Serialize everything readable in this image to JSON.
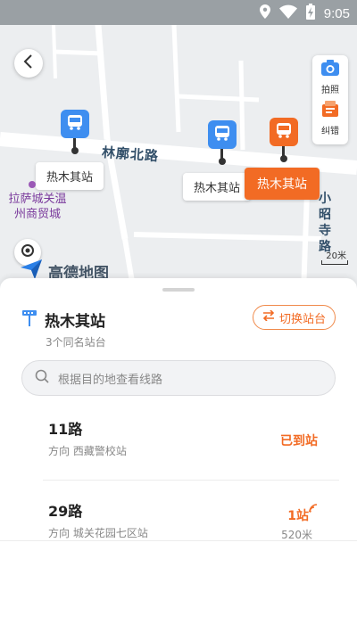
{
  "status_bar": {
    "time": "9:05"
  },
  "map": {
    "road_north": "林廓北路",
    "road_east": "小昭寺路",
    "poi_name_line1": "拉萨城关温",
    "poi_name_line2": "州商贸城",
    "station_labels": [
      "热木其站",
      "热木其站",
      "热木其站"
    ],
    "scale": "20米",
    "logo_text": "高德地图",
    "tools": {
      "photo": "拍照",
      "report": "纠错"
    }
  },
  "sheet": {
    "stop_name": "热木其站",
    "stop_sub": "3个同名站台",
    "switch_label": "切换站台",
    "search_placeholder": "根据目的地查看线路",
    "routes": [
      {
        "name": "11路",
        "direction": "方向 西藏警校站",
        "status": "已到站",
        "distance": ""
      },
      {
        "name": "29路",
        "direction": "方向 城关花园七区站",
        "status": "1站",
        "distance": "520米"
      }
    ]
  },
  "colors": {
    "accent": "#f26b24",
    "bus_blue": "#3e8ef0"
  }
}
